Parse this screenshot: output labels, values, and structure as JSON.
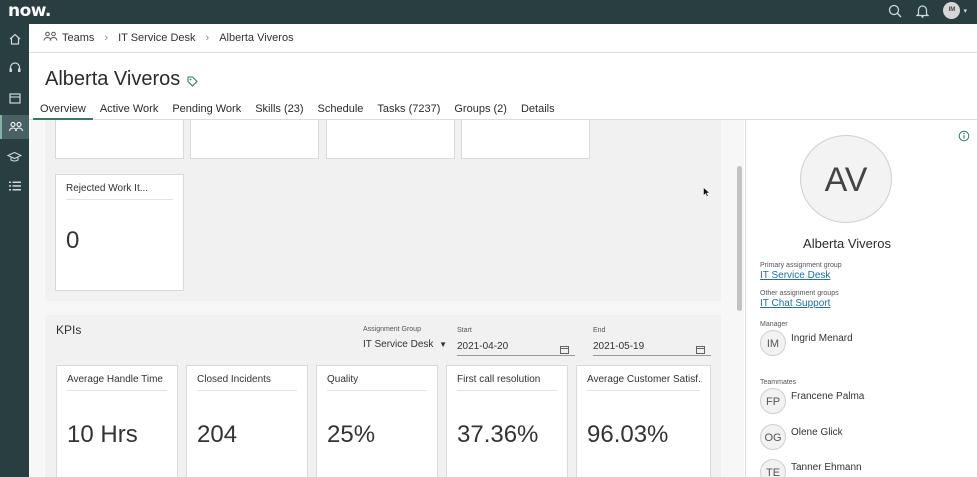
{
  "app": {
    "logo": "now."
  },
  "header": {
    "user_initials": "IM"
  },
  "breadcrumb": {
    "items": [
      "Teams",
      "IT Service Desk",
      "Alberta Viveros"
    ]
  },
  "page": {
    "title": "Alberta Viveros"
  },
  "tabs": [
    "Overview",
    "Active Work",
    "Pending Work",
    "Skills (23)",
    "Schedule",
    "Tasks (7237)",
    "Groups (2)",
    "Details"
  ],
  "work_items": {
    "rejected_title": "Rejected Work It...",
    "rejected_value": "0"
  },
  "kpis": {
    "heading": "KPIs",
    "assignment_group_label": "Assignment Group",
    "assignment_group_value": "IT Service Desk",
    "start_label": "Start",
    "start_value": "2021-04-20",
    "end_label": "End",
    "end_value": "2021-05-19",
    "cards": [
      {
        "title": "Average Handle Time",
        "value": "10 Hrs"
      },
      {
        "title": "Closed Incidents",
        "value": "204"
      },
      {
        "title": "Quality",
        "value": "25%"
      },
      {
        "title": "First call resolution",
        "value": "37.36%"
      },
      {
        "title": "Average Customer Satisf...",
        "value": "96.03%"
      }
    ]
  },
  "profile": {
    "initials": "AV",
    "name": "Alberta Viveros",
    "primary_group_label": "Primary assignment group",
    "primary_group": "IT Service Desk",
    "other_groups_label": "Other assignment groups",
    "other_group": "IT Chat Support",
    "manager_label": "Manager",
    "manager": {
      "initials": "IM",
      "name": "Ingrid Menard"
    },
    "teammates_label": "Teammates",
    "teammates": [
      {
        "initials": "FP",
        "name": "Francene Palma"
      },
      {
        "initials": "OG",
        "name": "Olene Glick"
      },
      {
        "initials": "TE",
        "name": "Tanner Ehmann"
      }
    ]
  },
  "colors": {
    "header_bg": "#293e40",
    "accent": "#2e7d6a",
    "link": "#1f6fa5"
  }
}
